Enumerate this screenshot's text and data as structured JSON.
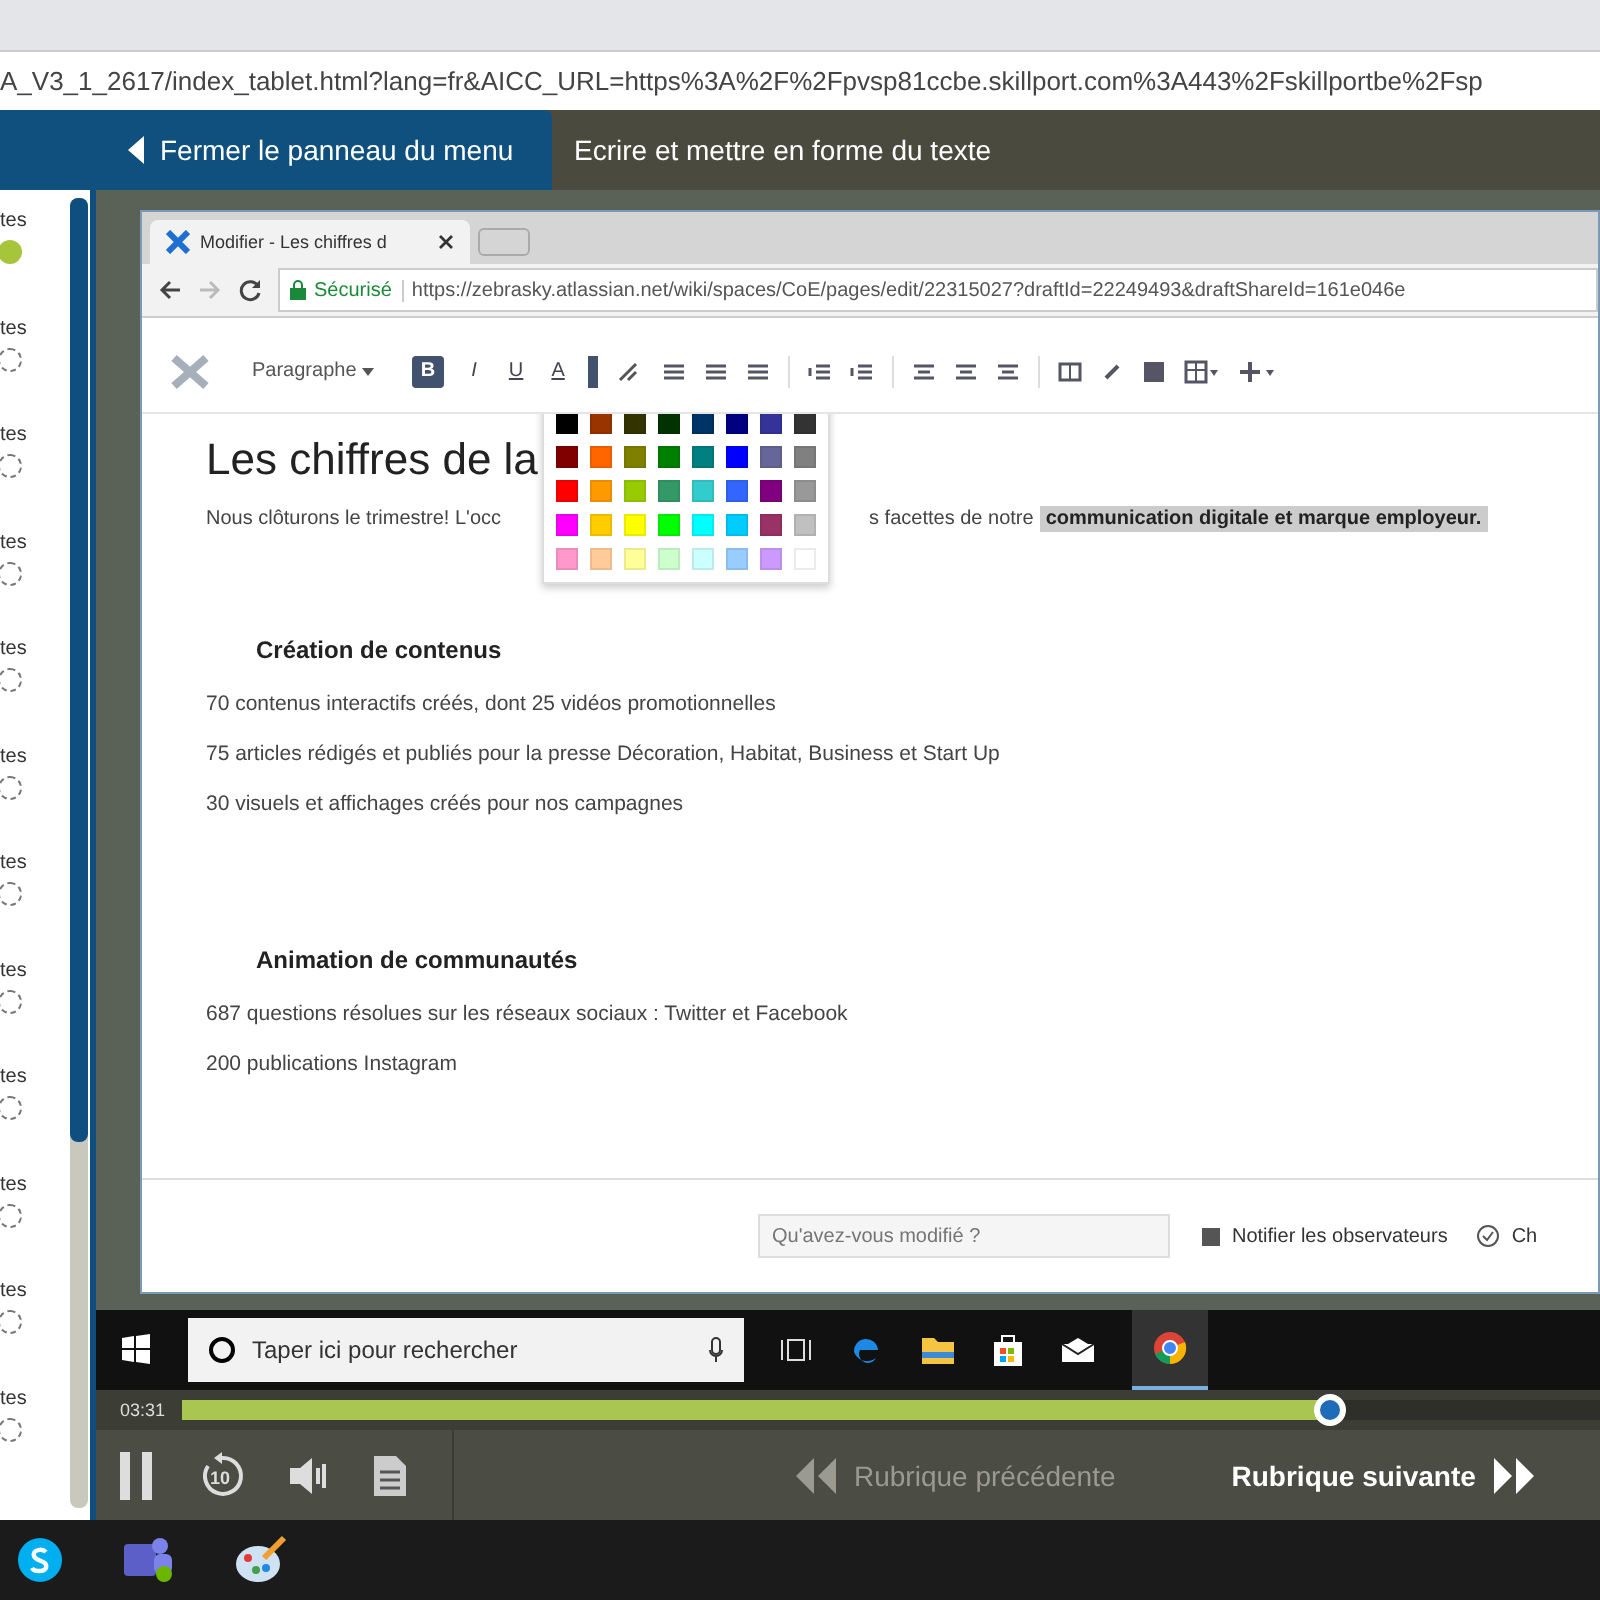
{
  "browser": {
    "url": "A_V3_1_2617/index_tablet.html?lang=fr&AICC_URL=https%3A%2F%2Fpvsp81ccbe.skillport.com%3A443%2Fskillportbe%2Fsp"
  },
  "header": {
    "menu_button": "Fermer le panneau du menu",
    "title": "Ecrire et mettre en forme du texte"
  },
  "sidebar": {
    "items": [
      {
        "label": "tes",
        "completed": true
      },
      {
        "label": "tes",
        "completed": false
      },
      {
        "label": "tes",
        "completed": false
      },
      {
        "label": "tes",
        "completed": false
      },
      {
        "label": "tes",
        "completed": false
      },
      {
        "label": "tes",
        "completed": false
      },
      {
        "label": "tes",
        "completed": false
      },
      {
        "label": "tes",
        "completed": false
      },
      {
        "label": "tes",
        "completed": false
      },
      {
        "label": "tes",
        "completed": false
      },
      {
        "label": "tes",
        "completed": false
      },
      {
        "label": "tes",
        "completed": false
      }
    ]
  },
  "video": {
    "tab": {
      "title": "Modifier - Les chiffres d"
    },
    "address": {
      "secure_label": "Sécurisé",
      "url": "https://zebrasky.atlassian.net/wiki/spaces/CoE/pages/edit/22315027?draftId=22249493&draftShareId=161e046e"
    },
    "toolbar": {
      "style_dropdown": "Paragraphe",
      "format_buttons": [
        "B",
        "I",
        "U",
        "A"
      ]
    },
    "palette": [
      {
        "color": "#000000"
      },
      {
        "color": "#993300"
      },
      {
        "color": "#333300"
      },
      {
        "color": "#003300"
      },
      {
        "color": "#003366"
      },
      {
        "color": "#000080"
      },
      {
        "color": "#333399"
      },
      {
        "color": "#333333"
      },
      {
        "color": "#800000"
      },
      {
        "color": "#ff6600"
      },
      {
        "color": "#808000"
      },
      {
        "color": "#008000"
      },
      {
        "color": "#008080"
      },
      {
        "color": "#0000ff"
      },
      {
        "color": "#666699"
      },
      {
        "color": "#808080"
      },
      {
        "color": "#ff0000"
      },
      {
        "color": "#ff9900"
      },
      {
        "color": "#99cc00"
      },
      {
        "color": "#339966"
      },
      {
        "color": "#33cccc"
      },
      {
        "color": "#3366ff"
      },
      {
        "color": "#800080"
      },
      {
        "color": "#999999"
      },
      {
        "color": "#ff00ff"
      },
      {
        "color": "#ffcc00"
      },
      {
        "color": "#ffff00"
      },
      {
        "color": "#00ff00"
      },
      {
        "color": "#00ffff"
      },
      {
        "color": "#00ccff"
      },
      {
        "color": "#993366"
      },
      {
        "color": "#c0c0c0"
      },
      {
        "color": "#ff99cc"
      },
      {
        "color": "#ffcc99"
      },
      {
        "color": "#ffff99"
      },
      {
        "color": "#ccffcc"
      },
      {
        "color": "#ccffff"
      },
      {
        "color": "#99ccff"
      },
      {
        "color": "#cc99ff"
      },
      {
        "color": "#ffffff"
      }
    ],
    "heading": "Les chiffres de la",
    "intro_start": "Nous clôturons le trimestre! L'occ",
    "intro_end": "s facettes de notre",
    "intro_highlight": "communication digitale et marque employeur.",
    "sections": [
      {
        "title": "Création de contenus",
        "lines": [
          "70 contenus interactifs créés, dont 25 vidéos promotionnelles",
          "75 articles rédigés et publiés pour la presse Décoration, Habitat, Business et Start Up",
          "30 visuels et affichages créés pour nos campagnes"
        ]
      },
      {
        "title": "Animation de communautés",
        "lines": [
          "687 questions résolues sur les réseaux sociaux : Twitter et Facebook",
          "200 publications Instagram"
        ]
      }
    ],
    "footer": {
      "placeholder": "Qu'avez-vous modifié ?",
      "notify_label": "Notifier les observateurs",
      "notify_checked": true,
      "cut_label": "Ch"
    },
    "taskbar_search": "Taper ici pour rechercher"
  },
  "player": {
    "time": "03:31",
    "level": 0.81,
    "replay_seconds": "10",
    "previous": {
      "label": "Rubrique précédente",
      "disabled": true
    },
    "next": {
      "label": "Rubrique suivante",
      "disabled": false
    }
  }
}
